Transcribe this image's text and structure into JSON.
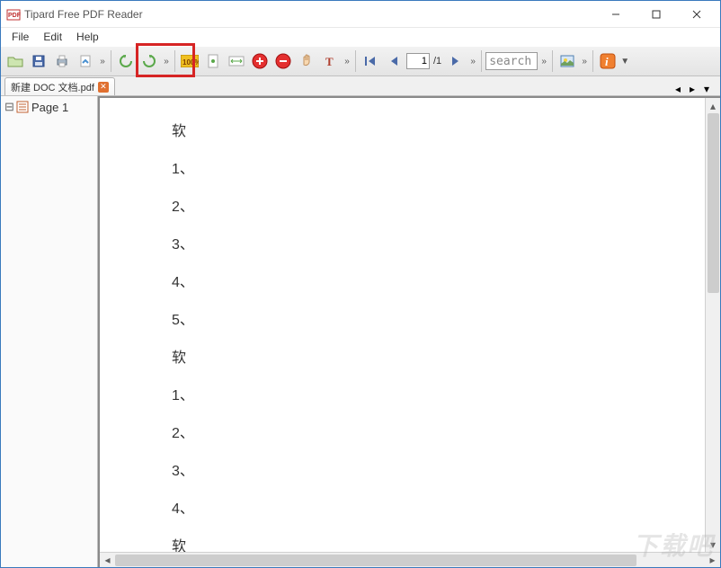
{
  "window": {
    "title": "Tipard Free PDF Reader"
  },
  "menu": {
    "file": "File",
    "edit": "Edit",
    "help": "Help"
  },
  "toolbar": {
    "page_current": "1",
    "page_total": "/1",
    "search_placeholder": "search"
  },
  "tab": {
    "name": "新建 DOC 文档.pdf"
  },
  "tree": {
    "page1": "Page 1"
  },
  "doc": {
    "lines": [
      "软",
      "1、",
      "2、",
      "3、",
      "4、",
      "5、",
      "软",
      "1、",
      "2、",
      "3、",
      "4、",
      "软"
    ]
  },
  "watermark": "下载吧"
}
